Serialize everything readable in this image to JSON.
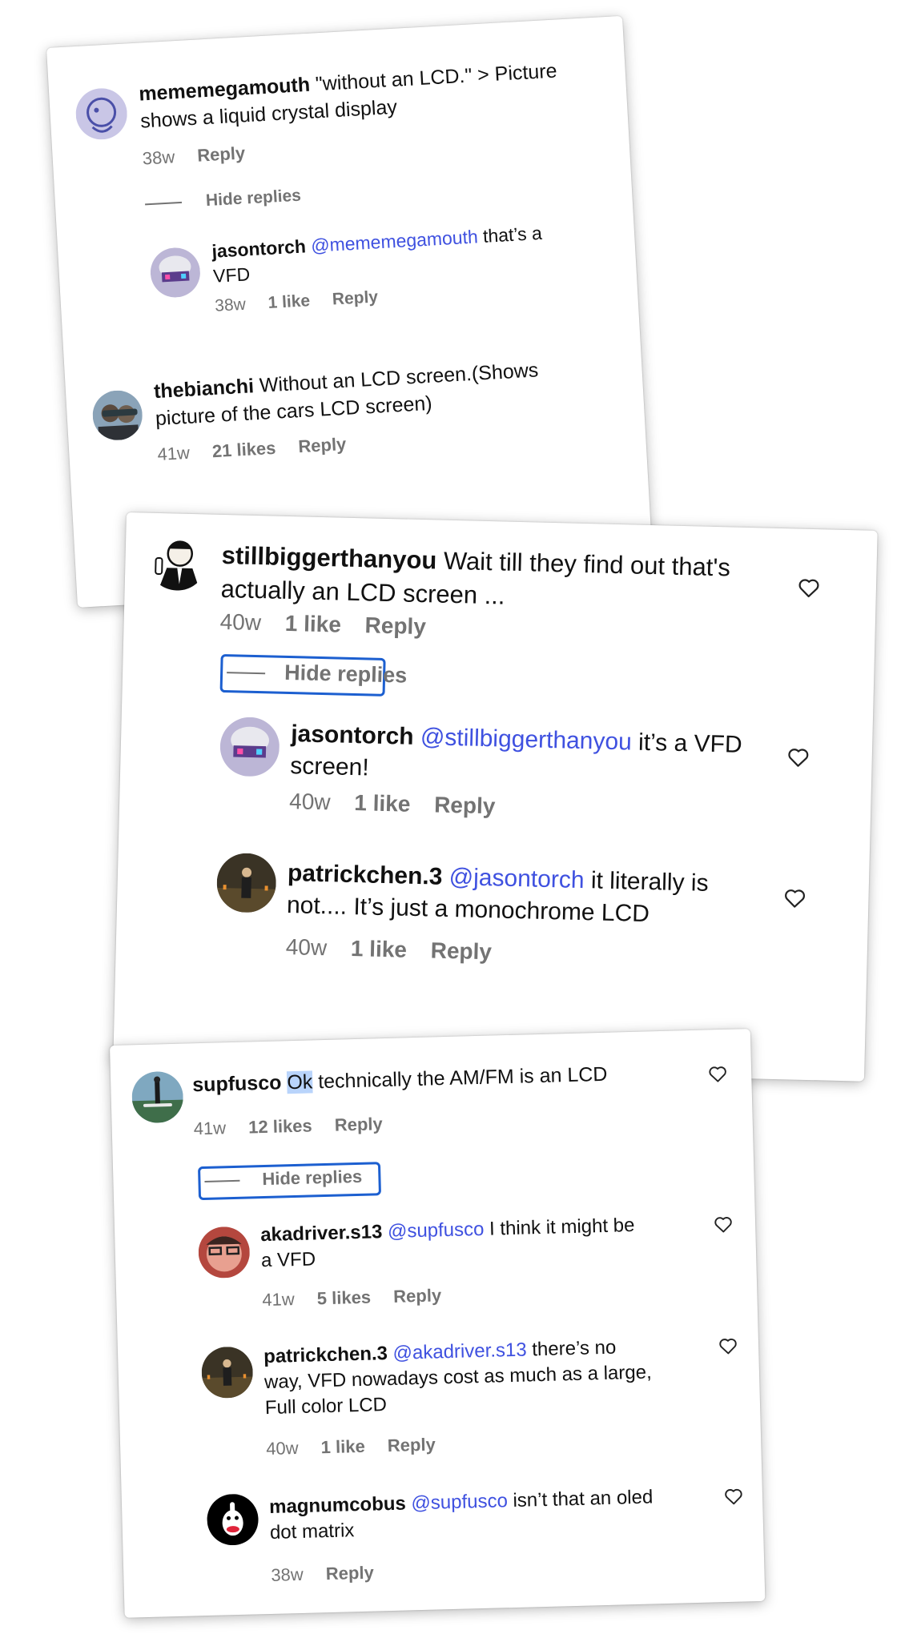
{
  "cards": [
    {
      "comments": [
        {
          "username": "mememegamouth",
          "text": "\"without an LCD.\" > Picture shows a liquid crystal display",
          "time": "38w",
          "reply": "Reply"
        },
        {
          "username": "jasontorch",
          "mention": "@mememegamouth",
          "text": "that’s a VFD",
          "time": "38w",
          "likes": "1 like",
          "reply": "Reply"
        },
        {
          "username": "thebianchi",
          "text": "Without an LCD screen.(Shows picture of the cars LCD screen)",
          "time": "41w",
          "likes": "21 likes",
          "reply": "Reply"
        }
      ],
      "hide_replies": "Hide replies"
    },
    {
      "comments": [
        {
          "username": "stillbiggerthanyou",
          "text": "Wait till they find out that's actually an LCD screen ...",
          "time": "40w",
          "likes": "1 like",
          "reply": "Reply"
        },
        {
          "username": "jasontorch",
          "mention": "@stillbiggerthanyou",
          "text": "it’s a VFD screen!",
          "time": "40w",
          "likes": "1 like",
          "reply": "Reply"
        },
        {
          "username": "patrickchen.3",
          "mention": "@jasontorch",
          "text": "it literally is not.... It’s just a monochrome LCD",
          "time": "40w",
          "likes": "1 like",
          "reply": "Reply"
        }
      ],
      "hide_replies": "Hide replies"
    },
    {
      "comments": [
        {
          "username": "supfusco",
          "highlight": "Ok",
          "text": "technically the AM/FM is an LCD",
          "time": "41w",
          "likes": "12 likes",
          "reply": "Reply"
        },
        {
          "username": "akadriver.s13",
          "mention": "@supfusco",
          "text": "I think it might be a VFD",
          "time": "41w",
          "likes": "5 likes",
          "reply": "Reply"
        },
        {
          "username": "patrickchen.3",
          "mention": "@akadriver.s13",
          "text": "there’s no way, VFD nowadays cost as much as a large, Full color LCD",
          "time": "40w",
          "likes": "1 like",
          "reply": "Reply"
        },
        {
          "username": "magnumcobus",
          "mention": "@supfusco",
          "text": "isn’t that an oled dot matrix",
          "time": "38w",
          "reply": "Reply"
        }
      ],
      "hide_replies": "Hide replies"
    }
  ],
  "colors": {
    "mention": "#3f51e0",
    "muted": "#737373",
    "highlight_box": "#1c5fd0",
    "selection": "#b9d4fb"
  },
  "icons": {
    "like": "heart-outline-icon"
  }
}
